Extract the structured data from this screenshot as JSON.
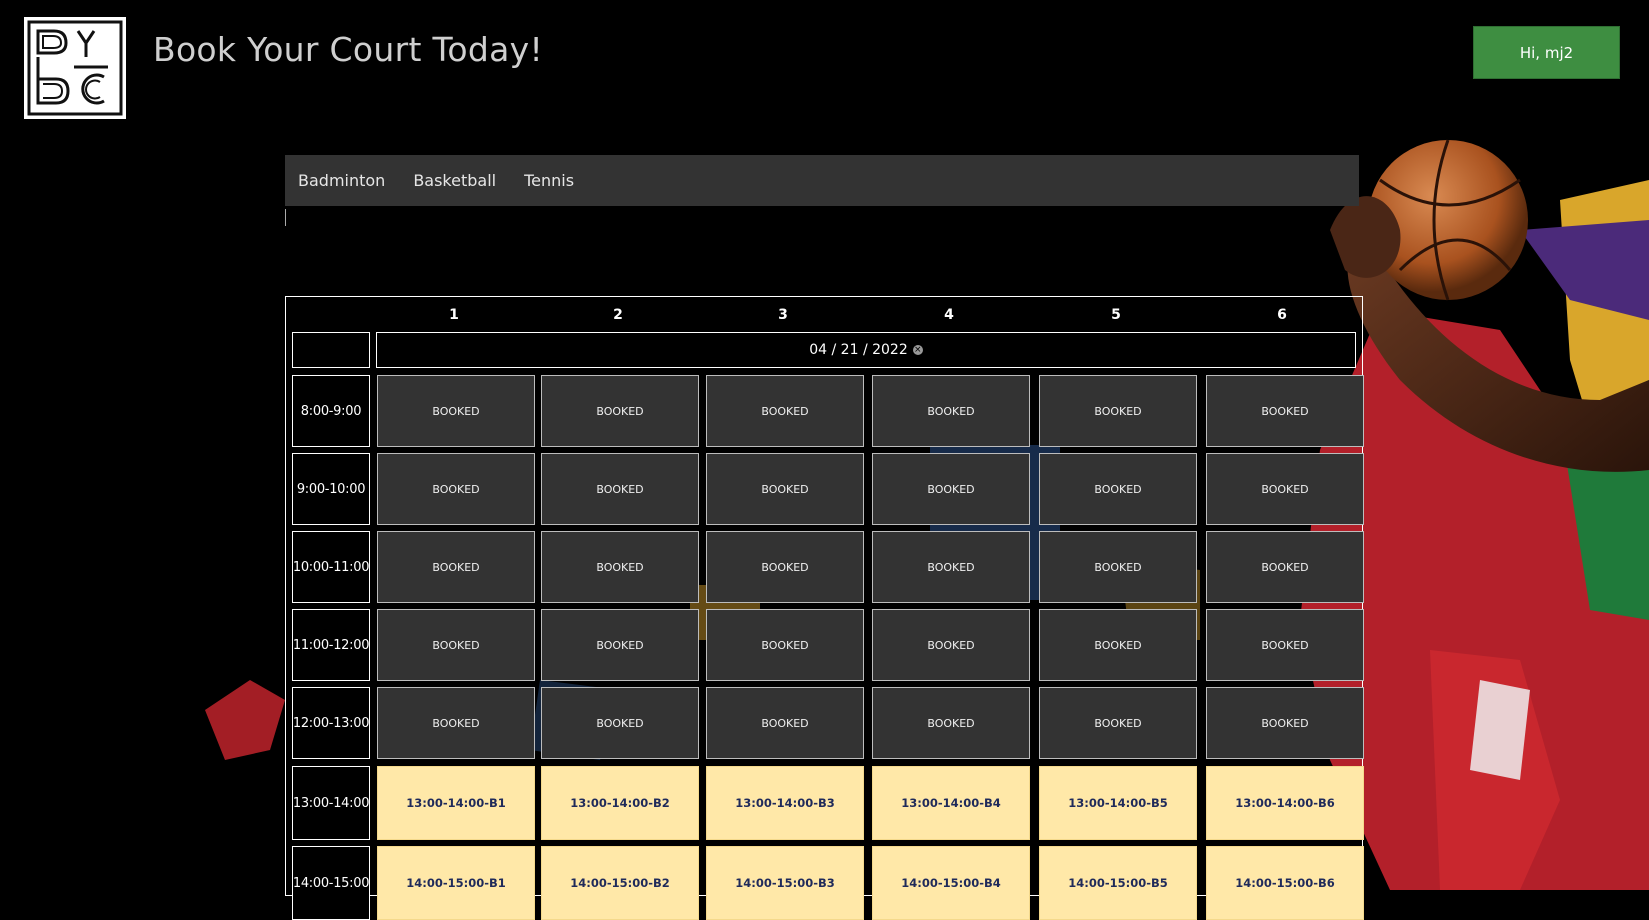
{
  "header": {
    "logo_icon": "byc-monogram-logo",
    "logo_letters": "BYCC",
    "title": "Book Your Court Today!",
    "user_button": "Hi, mj2",
    "user_button_color": "#3e8e41"
  },
  "nav": {
    "tabs": [
      {
        "label": "Badminton"
      },
      {
        "label": "Basketball"
      },
      {
        "label": "Tennis"
      }
    ]
  },
  "schedule": {
    "courts": [
      "1",
      "2",
      "3",
      "4",
      "5",
      "6"
    ],
    "date": "04 / 21 / 2022",
    "clear_icon": "clear-x-icon",
    "rows": [
      {
        "time": "8:00-9:00",
        "slots": [
          "BOOKED",
          "BOOKED",
          "BOOKED",
          "BOOKED",
          "BOOKED",
          "BOOKED"
        ],
        "status": "booked"
      },
      {
        "time": "9:00-10:00",
        "slots": [
          "BOOKED",
          "BOOKED",
          "BOOKED",
          "BOOKED",
          "BOOKED",
          "BOOKED"
        ],
        "status": "booked"
      },
      {
        "time": "10:00-11:00",
        "slots": [
          "BOOKED",
          "BOOKED",
          "BOOKED",
          "BOOKED",
          "BOOKED",
          "BOOKED"
        ],
        "status": "booked"
      },
      {
        "time": "11:00-12:00",
        "slots": [
          "BOOKED",
          "BOOKED",
          "BOOKED",
          "BOOKED",
          "BOOKED",
          "BOOKED"
        ],
        "status": "booked"
      },
      {
        "time": "12:00-13:00",
        "slots": [
          "BOOKED",
          "BOOKED",
          "BOOKED",
          "BOOKED",
          "BOOKED",
          "BOOKED"
        ],
        "status": "booked"
      },
      {
        "time": "13:00-14:00",
        "slots": [
          "13:00-14:00-B1",
          "13:00-14:00-B2",
          "13:00-14:00-B3",
          "13:00-14:00-B4",
          "13:00-14:00-B5",
          "13:00-14:00-B6"
        ],
        "status": "available"
      },
      {
        "time": "14:00-15:00",
        "slots": [
          "14:00-15:00-B1",
          "14:00-15:00-B2",
          "14:00-15:00-B3",
          "14:00-15:00-B4",
          "14:00-15:00-B5",
          "14:00-15:00-B6"
        ],
        "status": "available"
      }
    ]
  },
  "colors": {
    "booked_bg": "#333333",
    "available_bg": "#ffe8a8",
    "nav_bg": "#333333"
  }
}
